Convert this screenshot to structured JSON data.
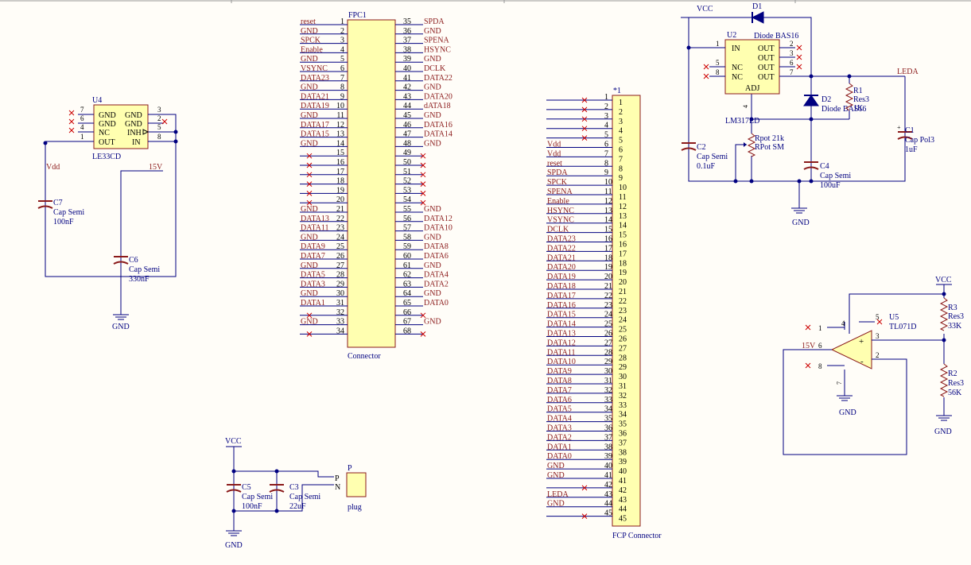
{
  "fpc1": {
    "designator": "FPC1",
    "comment": "Connector",
    "left": [
      [
        "1",
        "reset"
      ],
      [
        "2",
        "GND"
      ],
      [
        "3",
        "SPCK"
      ],
      [
        "4",
        "Enable"
      ],
      [
        "5",
        "GND"
      ],
      [
        "6",
        "VSYNC"
      ],
      [
        "7",
        "DATA23"
      ],
      [
        "8",
        "GND"
      ],
      [
        "9",
        "DATA21"
      ],
      [
        "10",
        "DATA19"
      ],
      [
        "11",
        "GND"
      ],
      [
        "12",
        "DATA17"
      ],
      [
        "13",
        "DATA15"
      ],
      [
        "14",
        "GND"
      ],
      [
        "15",
        ""
      ],
      [
        "16",
        ""
      ],
      [
        "17",
        ""
      ],
      [
        "18",
        ""
      ],
      [
        "19",
        ""
      ],
      [
        "20",
        ""
      ],
      [
        "21",
        "GND"
      ],
      [
        "22",
        "DATA13"
      ],
      [
        "23",
        "DATA11"
      ],
      [
        "24",
        "GND"
      ],
      [
        "25",
        "DATA9"
      ],
      [
        "26",
        "DATA7"
      ],
      [
        "27",
        "GND"
      ],
      [
        "28",
        "DATA5"
      ],
      [
        "29",
        "DATA3"
      ],
      [
        "30",
        "GND"
      ],
      [
        "31",
        "DATA1"
      ],
      [
        "32",
        ""
      ],
      [
        "33",
        "GND"
      ],
      [
        "34",
        ""
      ]
    ],
    "right": [
      [
        "35",
        "SPDA"
      ],
      [
        "36",
        "GND"
      ],
      [
        "37",
        "SPENA"
      ],
      [
        "38",
        "HSYNC"
      ],
      [
        "39",
        "GND"
      ],
      [
        "40",
        "DCLK"
      ],
      [
        "41",
        "DATA22"
      ],
      [
        "42",
        "GND"
      ],
      [
        "43",
        "DATA20"
      ],
      [
        "44",
        "dATA18"
      ],
      [
        "45",
        "GND"
      ],
      [
        "46",
        "DATA16"
      ],
      [
        "47",
        "DATA14"
      ],
      [
        "48",
        "GND"
      ],
      [
        "49",
        ""
      ],
      [
        "50",
        ""
      ],
      [
        "51",
        ""
      ],
      [
        "52",
        ""
      ],
      [
        "53",
        ""
      ],
      [
        "54",
        ""
      ],
      [
        "55",
        "GND"
      ],
      [
        "56",
        "DATA12"
      ],
      [
        "57",
        "DATA10"
      ],
      [
        "58",
        "GND"
      ],
      [
        "59",
        "DATA8"
      ],
      [
        "60",
        "DATA6"
      ],
      [
        "61",
        "GND"
      ],
      [
        "62",
        "DATA4"
      ],
      [
        "63",
        "DATA2"
      ],
      [
        "64",
        "GND"
      ],
      [
        "65",
        "DATA0"
      ],
      [
        "66",
        ""
      ],
      [
        "67",
        "GND"
      ],
      [
        "68",
        ""
      ]
    ]
  },
  "fcp": {
    "designator": "*1",
    "comment": "FCP Connector",
    "pins": [
      [
        "1",
        ""
      ],
      [
        "2",
        ""
      ],
      [
        "3",
        ""
      ],
      [
        "4",
        ""
      ],
      [
        "5",
        ""
      ],
      [
        "6",
        "Vdd"
      ],
      [
        "7",
        "Vdd"
      ],
      [
        "8",
        "reset"
      ],
      [
        "9",
        "SPDA"
      ],
      [
        "10",
        "SPCK"
      ],
      [
        "11",
        "SPENA"
      ],
      [
        "12",
        "Enable"
      ],
      [
        "13",
        "HSYNC"
      ],
      [
        "14",
        "VSYNC"
      ],
      [
        "15",
        "DCLK"
      ],
      [
        "16",
        "DATA23"
      ],
      [
        "17",
        "DATA22"
      ],
      [
        "18",
        "DATA21"
      ],
      [
        "19",
        "DATA20"
      ],
      [
        "20",
        "DATA19"
      ],
      [
        "21",
        "DATA18"
      ],
      [
        "22",
        "DATA17"
      ],
      [
        "23",
        "DATA16"
      ],
      [
        "24",
        "DATA15"
      ],
      [
        "25",
        "DATA14"
      ],
      [
        "26",
        "DATA13"
      ],
      [
        "27",
        "DATA12"
      ],
      [
        "28",
        "DATA11"
      ],
      [
        "29",
        "DATA10"
      ],
      [
        "30",
        "DATA9"
      ],
      [
        "31",
        "DATA8"
      ],
      [
        "32",
        "DATA7"
      ],
      [
        "33",
        "DATA6"
      ],
      [
        "34",
        "DATA5"
      ],
      [
        "35",
        "DATA4"
      ],
      [
        "36",
        "DATA3"
      ],
      [
        "37",
        "DATA2"
      ],
      [
        "38",
        "DATA1"
      ],
      [
        "39",
        "DATA0"
      ],
      [
        "40",
        "GND"
      ],
      [
        "41",
        "GND"
      ],
      [
        "42",
        ""
      ],
      [
        "43",
        "LEDA"
      ],
      [
        "44",
        "GND"
      ],
      [
        "45",
        ""
      ]
    ]
  },
  "u4": {
    "designator": "U4",
    "comment": "LE33CD",
    "left_pins": [
      [
        "7",
        "GND"
      ],
      [
        "6",
        "GND"
      ],
      [
        "4",
        "NC"
      ],
      [
        "1",
        "OUT"
      ]
    ],
    "right_pins": [
      [
        "3",
        "GND"
      ],
      [
        "2",
        "GND"
      ],
      [
        "5",
        "INH"
      ],
      [
        "8",
        "IN"
      ]
    ],
    "net_vdd": "Vdd",
    "net_15v": "15V"
  },
  "c7": {
    "designator": "C7",
    "type": "Cap Semi",
    "value": "100nF"
  },
  "c6": {
    "designator": "C6",
    "type": "Cap Semi",
    "value": "330nF"
  },
  "gnd_label": "GND",
  "vcc_label": "VCC",
  "c5": {
    "designator": "C5",
    "type": "Cap Semi",
    "value": "100nF"
  },
  "c3": {
    "designator": "C3",
    "type": "Cap Semi",
    "value": "22uF"
  },
  "plug": {
    "designator": "P",
    "comment": "plug",
    "pin_p": "P",
    "pin_n": "N"
  },
  "u2": {
    "designator": "U2",
    "comment": "LM317LD",
    "pin_in": "IN",
    "pin_in_num": "1",
    "pin_nc1": "NC",
    "pin_nc2": "NC",
    "pin_nc1_num": "5",
    "pin_nc2_num": "8",
    "pin_out": "OUT",
    "out_nums": [
      "2",
      "3",
      "6",
      "7"
    ],
    "pin_adj": "ADJ",
    "adj_num": "4"
  },
  "d1": {
    "designator": "D1",
    "comment": "Diode BAS16"
  },
  "d2": {
    "designator": "D2",
    "comment": "Diode BAS16"
  },
  "r1": {
    "designator": "R1",
    "type": "Res3",
    "value": "1K"
  },
  "rpot": {
    "designator": "Rpot 21k",
    "type": "RPot SM"
  },
  "c2": {
    "designator": "C2",
    "type": "Cap Semi",
    "value": "0.1uF"
  },
  "c4": {
    "designator": "C4",
    "type": "Cap Semi",
    "value": "100uF"
  },
  "c1": {
    "designator": "C1",
    "type": "Cap Pol3",
    "value": "1uF"
  },
  "leda_label": "LEDA",
  "u5": {
    "designator": "U5",
    "comment": "TL071D",
    "pins": [
      "1",
      "4",
      "5",
      "2",
      "3",
      "6",
      "8",
      "7"
    ],
    "net_15v": "15V"
  },
  "r3": {
    "designator": "R3",
    "type": "Res3",
    "value": "33K"
  },
  "r2": {
    "designator": "R2",
    "type": "Res3",
    "value": "56K"
  }
}
